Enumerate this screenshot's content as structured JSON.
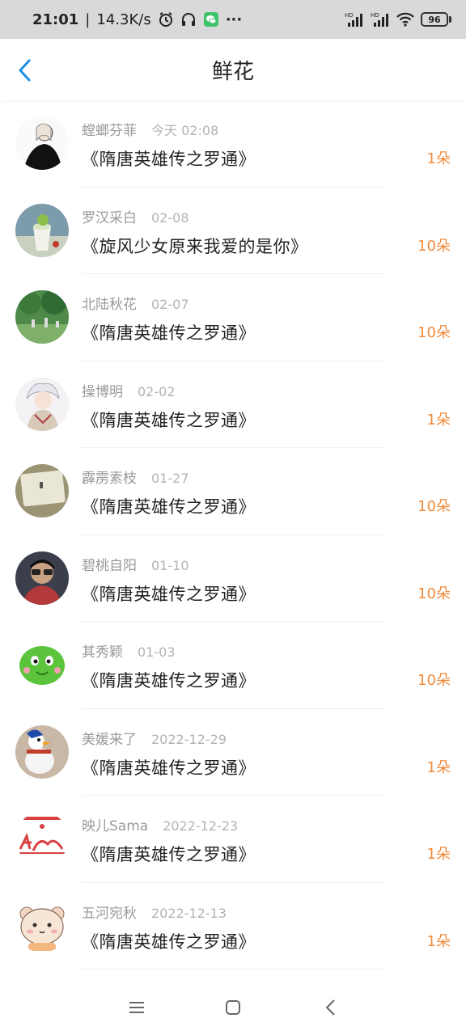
{
  "status_bar": {
    "time": "21:01",
    "speed": "14.3K/s",
    "more": "···",
    "battery": "96",
    "signal_label": "HD"
  },
  "header": {
    "title": "鲜花"
  },
  "colors": {
    "accent": "#f08a3a",
    "back_icon": "#1a8fe8",
    "username": "#9a9a9a",
    "date": "#b3b3b3"
  },
  "items": [
    {
      "name": "螳螂芬菲",
      "date": "今天 02:08",
      "book": "《隋唐英雄传之罗通》",
      "amount": "1朵"
    },
    {
      "name": "罗汉采白",
      "date": "02-08",
      "book": "《旋风少女原来我爱的是你》",
      "amount": "10朵"
    },
    {
      "name": "北陆秋花",
      "date": "02-07",
      "book": "《隋唐英雄传之罗通》",
      "amount": "10朵"
    },
    {
      "name": "操博明",
      "date": "02-02",
      "book": "《隋唐英雄传之罗通》",
      "amount": "1朵"
    },
    {
      "name": "霹雳素枝",
      "date": "01-27",
      "book": "《隋唐英雄传之罗通》",
      "amount": "10朵"
    },
    {
      "name": "碧桃自阳",
      "date": "01-10",
      "book": "《隋唐英雄传之罗通》",
      "amount": "10朵"
    },
    {
      "name": "其秀颖",
      "date": "01-03",
      "book": "《隋唐英雄传之罗通》",
      "amount": "10朵"
    },
    {
      "name": "美媛来了",
      "date": "2022-12-29",
      "book": "《隋唐英雄传之罗通》",
      "amount": "1朵"
    },
    {
      "name": "映儿Sama",
      "date": "2022-12-23",
      "book": "《隋唐英雄传之罗通》",
      "amount": "1朵"
    },
    {
      "name": "五河宛秋",
      "date": "2022-12-13",
      "book": "《隋唐英雄传之罗通》",
      "amount": "1朵"
    }
  ],
  "icons": {
    "back": "chevron-left-icon",
    "alarm": "alarm-icon",
    "headphones": "headphones-icon",
    "wechat": "wechat-icon",
    "wifi": "wifi-icon",
    "signal": "signal-icon",
    "battery": "battery-icon",
    "menu": "menu-icon",
    "home": "home-icon",
    "back_nav": "back-icon"
  }
}
